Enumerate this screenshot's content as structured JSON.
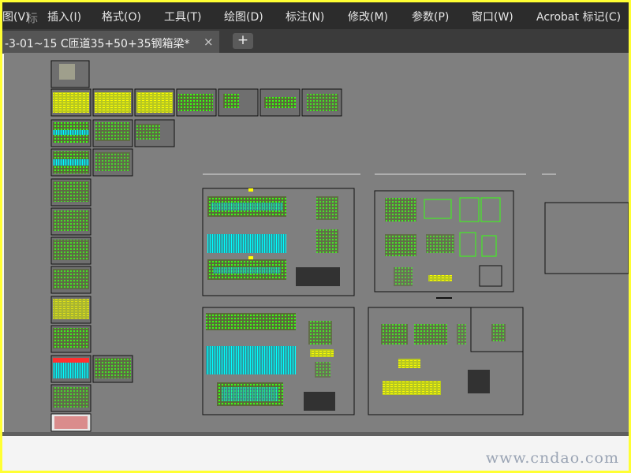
{
  "menubar": {
    "items": [
      "图(V)",
      "插入(I)",
      "格式(O)",
      "工具(T)",
      "绘图(D)",
      "标注(N)",
      "修改(M)",
      "参数(P)",
      "窗口(W)",
      "Acrobat 标记(C)"
    ],
    "ghost_text": "标"
  },
  "tabs": {
    "active_label": "-3-01~15  C匝道35+50+35钢箱梁*",
    "close_icon": "×",
    "add_icon": "+"
  },
  "watermark": "www.cndao.com",
  "colors": {
    "menubar_bg": "#2c2c2c",
    "canvas_bg": "#7f7f7f",
    "drawing_green": "#39ff14",
    "drawing_yellow": "#ffff00",
    "drawing_cyan": "#00ffff",
    "frame_yellow": "#ffff33"
  }
}
